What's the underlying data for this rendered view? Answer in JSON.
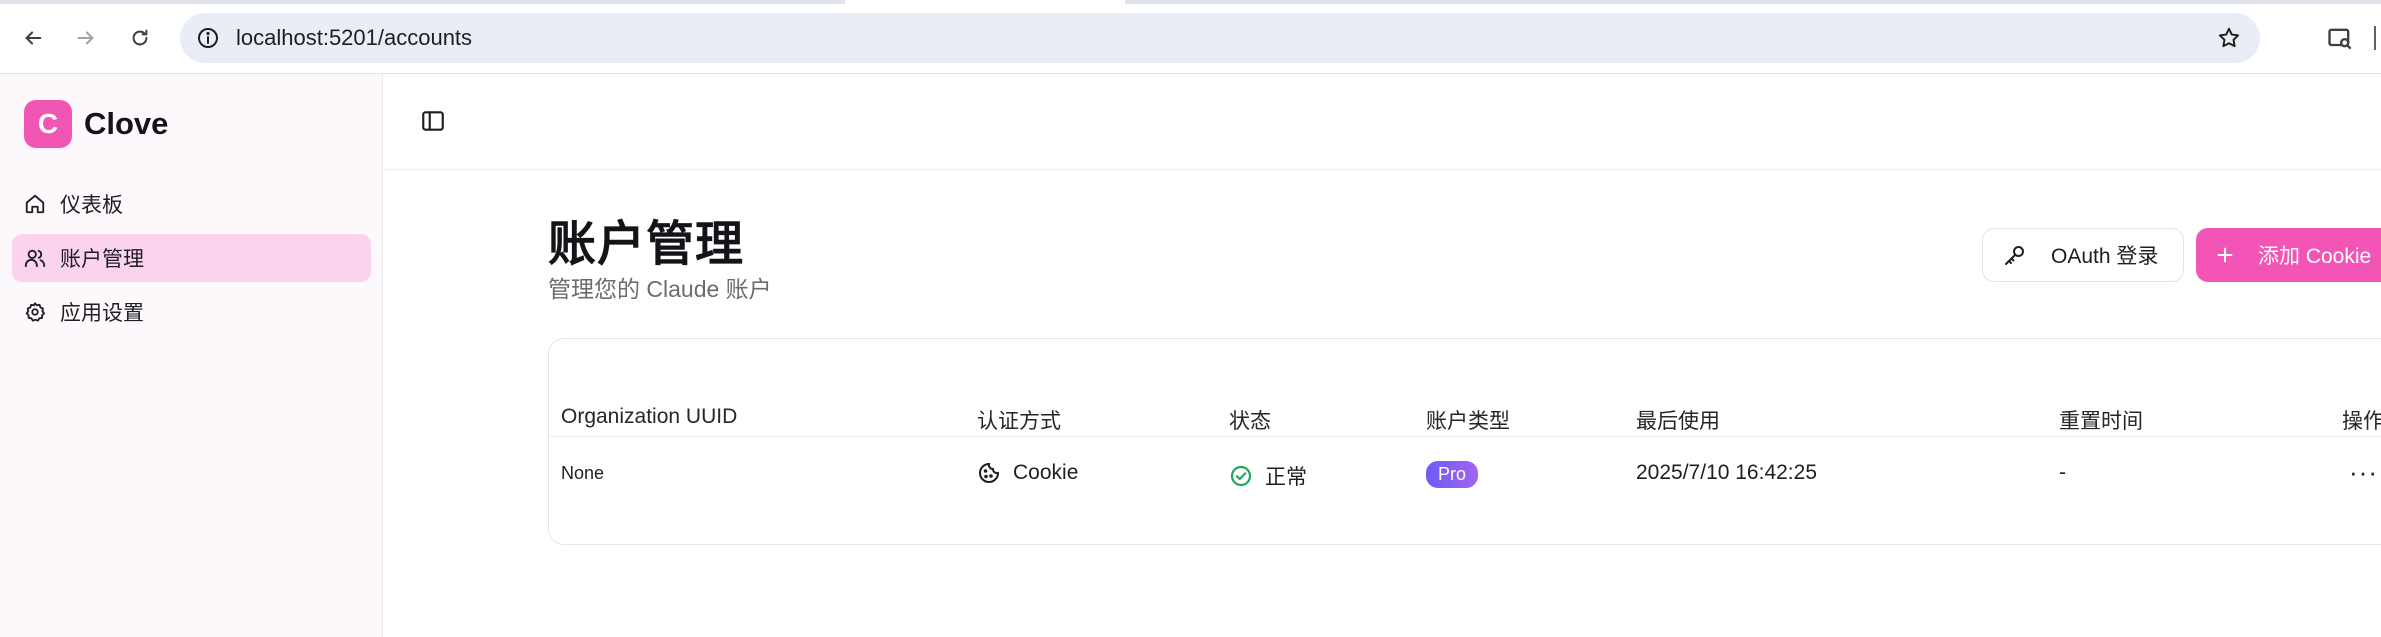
{
  "browser": {
    "url": "localhost:5201/accounts",
    "icons": [
      "back-icon",
      "forward-icon",
      "reload-icon",
      "site-info-icon",
      "star-icon",
      "tab-search-icon"
    ]
  },
  "sidebar": {
    "logo_letter": "C",
    "app_name": "Clove",
    "items": [
      {
        "label": "仪表板",
        "icon": "home-icon",
        "active": false
      },
      {
        "label": "账户管理",
        "icon": "users-icon",
        "active": true
      },
      {
        "label": "应用设置",
        "icon": "gear-icon",
        "active": false
      }
    ]
  },
  "main": {
    "title": "账户管理",
    "subtitle": "管理您的 Claude 账户",
    "buttons": {
      "oauth_label": "OAuth 登录",
      "add_cookie_label": "添加 Cookie"
    },
    "table": {
      "columns": [
        "Organization UUID",
        "认证方式",
        "状态",
        "账户类型",
        "最后使用",
        "重置时间",
        "操作"
      ],
      "rows": [
        {
          "uuid": "None",
          "auth": "Cookie",
          "status": "正常",
          "type": "Pro",
          "last_used": "2025/7/10 16:42:25",
          "reset": "-",
          "actions": "···"
        }
      ]
    }
  },
  "colors": {
    "brand": "#f256b5",
    "active_nav": "#fbd3ef",
    "status_ok": "#1fa75a",
    "badge_from": "#6d5cf6",
    "badge_to": "#a263f2"
  }
}
